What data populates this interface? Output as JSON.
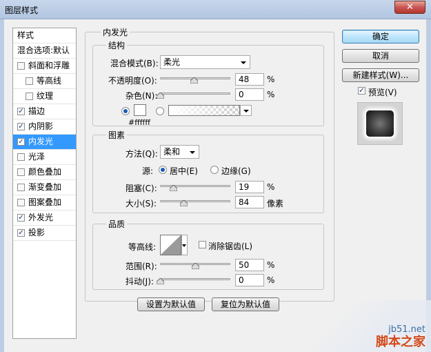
{
  "window": {
    "title": "图层样式",
    "close_glyph": "✕"
  },
  "style_list": {
    "header": "样式",
    "blend_options": "混合选项:默认",
    "items": [
      {
        "label": "斜面和浮雕",
        "checked": false,
        "indent": false
      },
      {
        "label": "等高线",
        "checked": false,
        "indent": true
      },
      {
        "label": "纹理",
        "checked": false,
        "indent": true
      },
      {
        "label": "描边",
        "checked": true,
        "indent": false
      },
      {
        "label": "内阴影",
        "checked": true,
        "indent": false
      },
      {
        "label": "内发光",
        "checked": true,
        "indent": false,
        "selected": true
      },
      {
        "label": "光泽",
        "checked": false,
        "indent": false
      },
      {
        "label": "颜色叠加",
        "checked": false,
        "indent": false
      },
      {
        "label": "渐变叠加",
        "checked": false,
        "indent": false
      },
      {
        "label": "图案叠加",
        "checked": false,
        "indent": false
      },
      {
        "label": "外发光",
        "checked": true,
        "indent": false
      },
      {
        "label": "投影",
        "checked": true,
        "indent": false
      }
    ]
  },
  "panel": {
    "title": "内发光",
    "structure": {
      "title": "结构",
      "blend_mode_label": "混合模式(B):",
      "blend_mode_value": "柔光",
      "opacity_label": "不透明度(O):",
      "opacity_value": "48",
      "opacity_unit": "%",
      "opacity_level": 0.48,
      "noise_label": "杂色(N):",
      "noise_value": "0",
      "noise_unit": "%",
      "noise_level": 0,
      "color_hex": "#ffffff"
    },
    "elements": {
      "title": "图素",
      "method_label": "方法(Q):",
      "method_value": "柔和",
      "source_label": "源:",
      "source_center": "居中(E)",
      "source_edge": "边缘(G)",
      "choke_label": "阻塞(C):",
      "choke_value": "19",
      "choke_unit": "%",
      "choke_level": 0.19,
      "size_label": "大小(S):",
      "size_value": "84",
      "size_unit": "像素",
      "size_level": 0.336
    },
    "quality": {
      "title": "品质",
      "contour_label": "等高线:",
      "antialias_label": "消除锯齿(L)",
      "range_label": "范围(R):",
      "range_value": "50",
      "range_unit": "%",
      "range_level": 0.5,
      "jitter_label": "抖动(J):",
      "jitter_value": "0",
      "jitter_unit": "%",
      "jitter_level": 0
    },
    "make_default": "设置为默认值",
    "reset_default": "复位为默认值"
  },
  "right": {
    "ok": "确定",
    "cancel": "取消",
    "new_style": "新建样式(W)...",
    "preview_label": "预览(V)",
    "preview_checked": true
  },
  "watermark": {
    "line1": "jb51.net",
    "line2": "脚本之家"
  }
}
